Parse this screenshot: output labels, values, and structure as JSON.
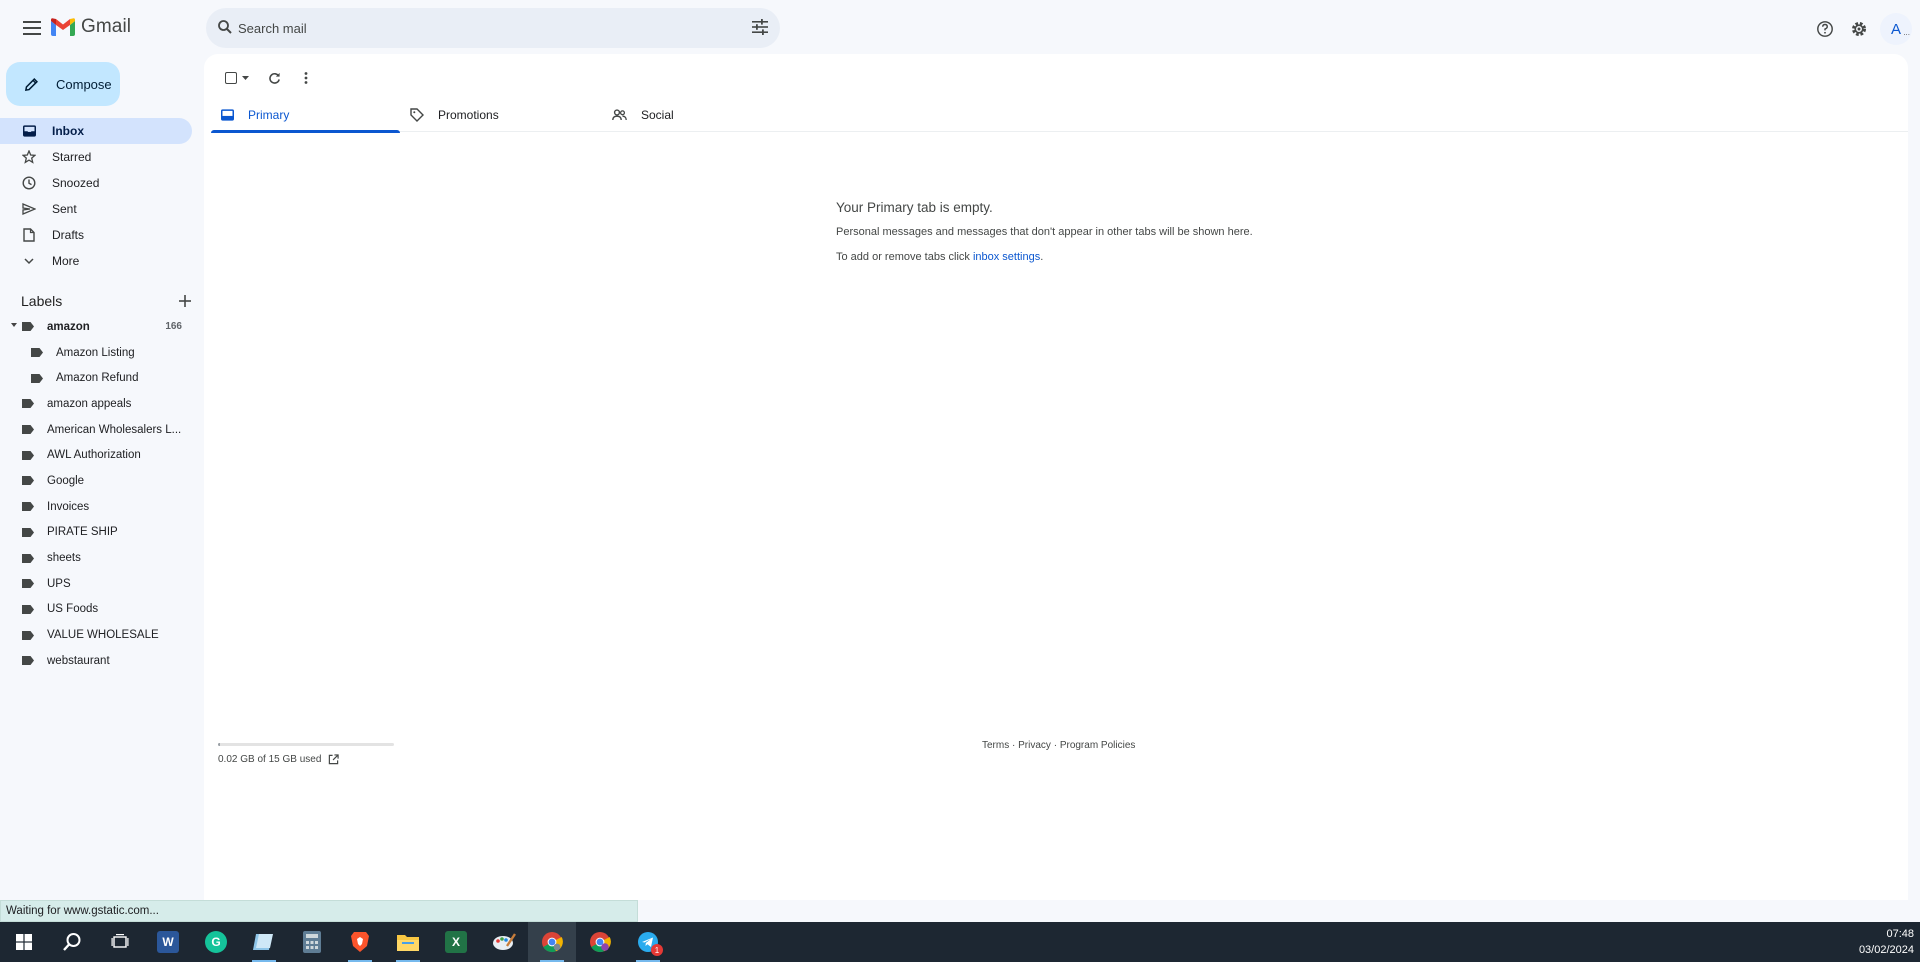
{
  "header": {
    "app_name": "Gmail",
    "search_placeholder": "Search mail",
    "avatar_letter": "A",
    "avatar_dots": "..."
  },
  "sidebar": {
    "compose_label": "Compose",
    "nav": [
      {
        "label": "Inbox",
        "icon": "inbox-icon",
        "active": true
      },
      {
        "label": "Starred",
        "icon": "star-icon"
      },
      {
        "label": "Snoozed",
        "icon": "clock-icon"
      },
      {
        "label": "Sent",
        "icon": "send-icon"
      },
      {
        "label": "Drafts",
        "icon": "draft-icon"
      },
      {
        "label": "More",
        "icon": "chevron-down-icon"
      }
    ],
    "labels_heading": "Labels",
    "labels": [
      {
        "name": "amazon",
        "count": "166"
      },
      {
        "name": "Amazon Listing"
      },
      {
        "name": "Amazon Refund"
      },
      {
        "name": "amazon appeals"
      },
      {
        "name": "American Wholesalers L..."
      },
      {
        "name": "AWL Authorization"
      },
      {
        "name": "Google"
      },
      {
        "name": "Invoices"
      },
      {
        "name": "PIRATE SHIP"
      },
      {
        "name": "sheets"
      },
      {
        "name": "UPS"
      },
      {
        "name": "US Foods"
      },
      {
        "name": "VALUE WHOLESALE"
      },
      {
        "name": "webstaurant"
      }
    ]
  },
  "main": {
    "tabs": [
      {
        "label": "Primary",
        "icon": "inbox-icon",
        "active": true
      },
      {
        "label": "Promotions",
        "icon": "tag-icon"
      },
      {
        "label": "Social",
        "icon": "people-icon"
      }
    ],
    "empty_title": "Your Primary tab is empty.",
    "empty_line1": "Personal messages and messages that don't appear in other tabs will be shown here.",
    "empty_line2_prefix": "To add or remove tabs click",
    "empty_line2_link": "inbox settings",
    "empty_line2_suffix": ".",
    "storage_text": "0.02 GB of 15 GB used",
    "storage_fraction": 0.0013,
    "footer": {
      "terms": "Terms",
      "sep": " · ",
      "privacy": "Privacy",
      "policies": "Program Policies"
    }
  },
  "status_bar": "Waiting for www.gstatic.com...",
  "taskbar": {
    "apps": [
      "windows-start",
      "search",
      "task-view",
      "word",
      "grammarly",
      "notepad",
      "calculator",
      "brave",
      "file-explorer",
      "excel",
      "paint",
      "chrome",
      "chrome-profile",
      "telegram"
    ],
    "telegram_badge": "1",
    "time": "07:48",
    "date": "03/02/2024"
  },
  "colors": {
    "accent": "#0b57d0",
    "compose": "#c2e7ff",
    "active_nav": "#d3e3fd"
  }
}
